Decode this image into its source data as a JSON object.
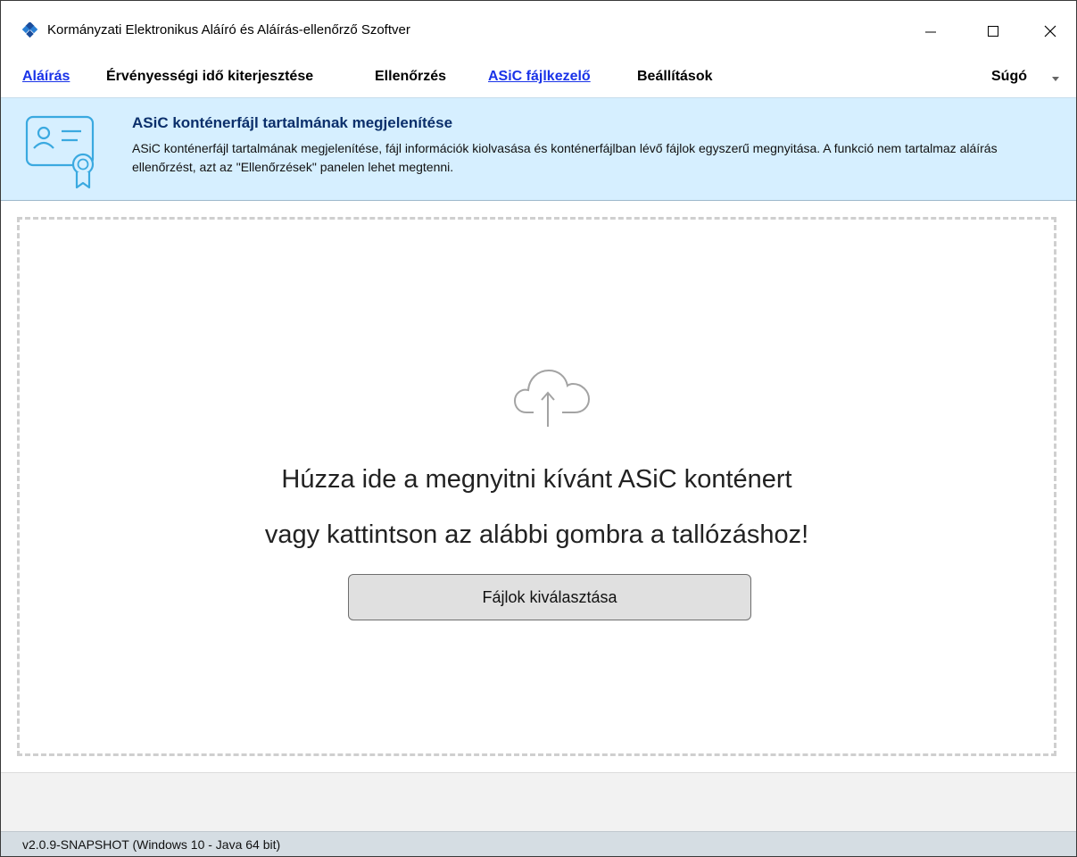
{
  "window": {
    "title": "Kormányzati Elektronikus Aláíró és Aláírás-ellenőrző Szoftver",
    "icon": "app-logo-icon",
    "controls": [
      "minimize-icon",
      "maximize-icon",
      "close-icon"
    ]
  },
  "menu": {
    "items": [
      {
        "label": "Aláírás",
        "style": "link"
      },
      {
        "label": "Érvényességi idő kiterjesztése",
        "style": "plain"
      },
      {
        "label": "Ellenőrzés",
        "style": "plain"
      },
      {
        "label": "ASiC fájlkezelő",
        "style": "link"
      },
      {
        "label": "Beállítások",
        "style": "plain"
      }
    ],
    "help_label": "Súgó"
  },
  "banner": {
    "icon": "certificate-icon",
    "title": "ASiC konténerfájl tartalmának megjelenítése",
    "description": "ASiC konténerfájl tartalmának megjelenítése, fájl információk kiolvasása és konténerfájlban lévő fájlok egyszerű megnyitása. A funkció nem tartalmaz aláírás ellenőrzést, azt az \"Ellenőrzések\" panelen lehet megtenni."
  },
  "dropzone": {
    "icon": "cloud-upload-icon",
    "line1": "Húzza ide a megnyitni kívánt ASiC konténert",
    "line2": "vagy kattintson az alábbi gombra a tallózáshoz!",
    "button_label": "Fájlok kiválasztása"
  },
  "status": {
    "version_text": "v2.0.9-SNAPSHOT (Windows 10 - Java 64 bit)"
  },
  "colors": {
    "link": "#1a33e8",
    "banner_bg": "#d6efff",
    "banner_title": "#0b2f6b",
    "icon_blue": "#3aa9e0",
    "status_bg": "#d5dde3"
  }
}
